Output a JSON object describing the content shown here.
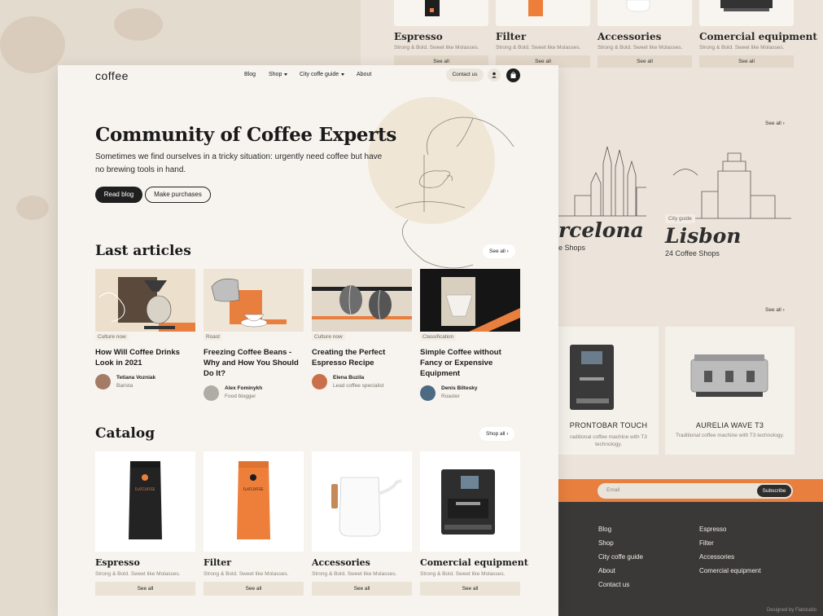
{
  "header": {
    "logo": "coffee",
    "nav": [
      {
        "label": "Blog"
      },
      {
        "label": "Shop"
      },
      {
        "label": "City coffe guide"
      },
      {
        "label": "About"
      }
    ],
    "contact_label": "Contact us"
  },
  "hero": {
    "title": "Community of Coffee Experts",
    "subtitle": "Sometimes we find ourselves in a tricky situation: urgently need coffee but have no brewing tools in hand.",
    "btn_primary": "Read blog",
    "btn_secondary": "Make purchases"
  },
  "articles": {
    "title": "Last articles",
    "see_all": "See all",
    "items": [
      {
        "tag": "Culture now",
        "title": "How Will Coffee Drinks Look in 2021",
        "author": "Tetiana Vozniak",
        "role": "Barista"
      },
      {
        "tag": "Roast",
        "title": "Freezing Coffee Beans - Why and How You Should Do It?",
        "author": "Alex Fominykh",
        "role": "Food blogger"
      },
      {
        "tag": "Culture now",
        "title": "Creating the Perfect Espresso Recipe",
        "author": "Elena Buzila",
        "role": "Lead coffee specialist"
      },
      {
        "tag": "Classification",
        "title": "Simple Coffee without Fancy or Expensive Equipment",
        "author": "Denis Biltesky",
        "role": "Roaster"
      }
    ]
  },
  "catalog": {
    "title": "Catalog",
    "shop_all": "Shop all",
    "items": [
      {
        "name": "Espresso",
        "desc": "Strong & Bold. Sweet like Molasses.",
        "see": "See all"
      },
      {
        "name": "Filter",
        "desc": "Strong & Bold. Sweet like Molasses.",
        "see": "See all"
      },
      {
        "name": "Accessories",
        "desc": "Strong & Bold. Sweet like Molasses.",
        "see": "See all"
      },
      {
        "name": "Comercial equipment",
        "desc": "Strong & Bold. Sweet like Molasses.",
        "see": "See all"
      }
    ]
  },
  "back_catalog": [
    {
      "name": "Espresso",
      "desc": "Strong & Bold. Sweet like Molasses.",
      "see": "See all"
    },
    {
      "name": "Filter",
      "desc": "Strong & Bold. Sweet like Molasses.",
      "see": "See all"
    },
    {
      "name": "Accessories",
      "desc": "Strong & Bold. Sweet like Molasses.",
      "see": "See all"
    },
    {
      "name": "Comercial equipment",
      "desc": "Strong & Bold. Sweet like Molasses.",
      "see": "See all"
    }
  ],
  "city_guide": {
    "see_all": "See all",
    "cities": [
      {
        "tag": "",
        "title": "rcelona",
        "count": "e Shops"
      },
      {
        "tag": "City guide",
        "title": "Lisbon",
        "count": "24  Coffee Shops"
      }
    ]
  },
  "machines": {
    "see_all": "See all",
    "items": [
      {
        "name": "PRONTOBAR TOUCH",
        "desc": "raditional coffee machine with T3 technology."
      },
      {
        "name": "AURELIA WAVE T3",
        "desc": "Traditional coffee machine with T3 technology."
      }
    ]
  },
  "subscribe": {
    "placeholder": "Email",
    "button": "Subscribe"
  },
  "footer": {
    "col1": [
      "Blog",
      "Shop",
      "City coffe guide",
      "About",
      "Contact us"
    ],
    "col2": [
      "Espresso",
      "Filter",
      "Accessories",
      "Comercial equipment"
    ],
    "credit": "Designed by Flatstudio"
  },
  "product_labels": {
    "bag": "FLATCOFFEE",
    "bag_sub": "BEAN ORIGINS & ORGANIC"
  },
  "colors": {
    "accent": "#e97f3f",
    "dark": "#1f1f1f",
    "page_bg": "#f7f4ef",
    "footer_bg": "#3a3938"
  }
}
